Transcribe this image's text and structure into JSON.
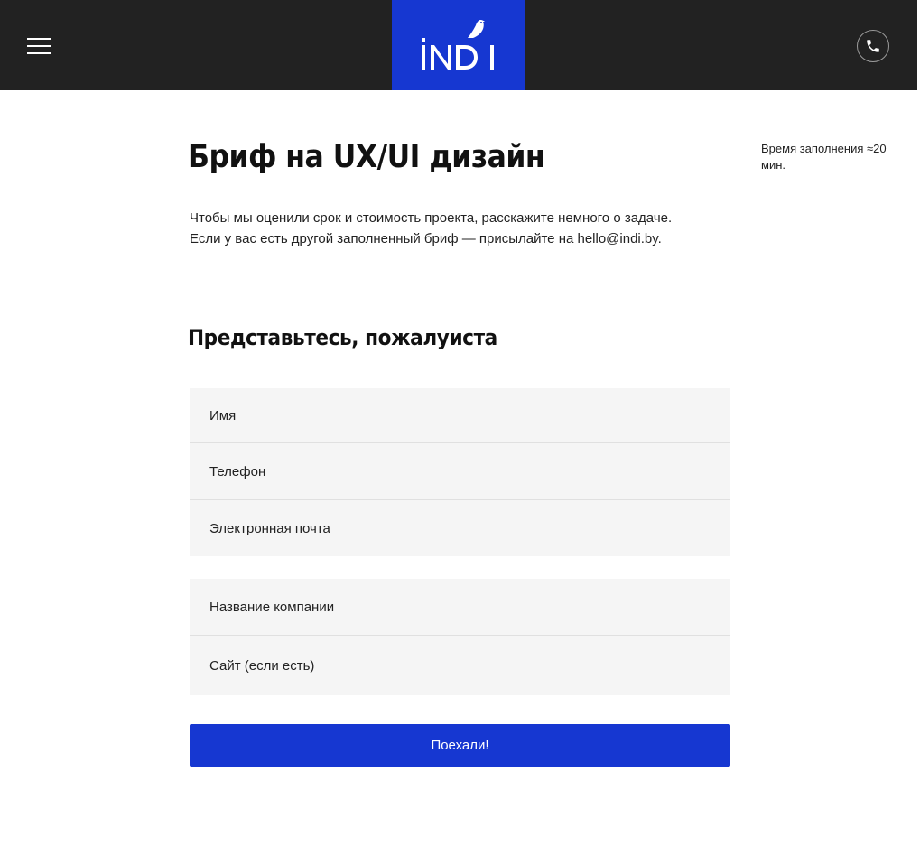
{
  "header": {
    "menu_icon": "hamburger-menu-icon",
    "logo_text": "iNDI",
    "logo_icon": "bird-logo-icon",
    "phone_icon": "phone-icon",
    "colors": {
      "background": "#222222",
      "logo_background": "#1637d1"
    }
  },
  "page": {
    "title": "Бриф на UX/UI дизайн",
    "fill_time": "Время заполнения ≈20 мин.",
    "intro": "Чтобы мы оценили срок и стоимость проекта, расскажите немного о задаче. Если у вас есть другой заполненный бриф — присылайте на hello@indi.by.",
    "section_title": "Представьтесь, пожалуиста"
  },
  "form": {
    "contact_fields": [
      {
        "placeholder": "Имя",
        "value": ""
      },
      {
        "placeholder": "Телефон",
        "value": ""
      },
      {
        "placeholder": "Электронная почта",
        "value": ""
      }
    ],
    "company_fields": [
      {
        "placeholder": "Название компании",
        "value": ""
      },
      {
        "placeholder": "Сайт (если есть)",
        "value": ""
      }
    ],
    "submit_label": "Поехали!",
    "colors": {
      "accent": "#1637d1",
      "field_background": "#f5f5f5"
    }
  }
}
